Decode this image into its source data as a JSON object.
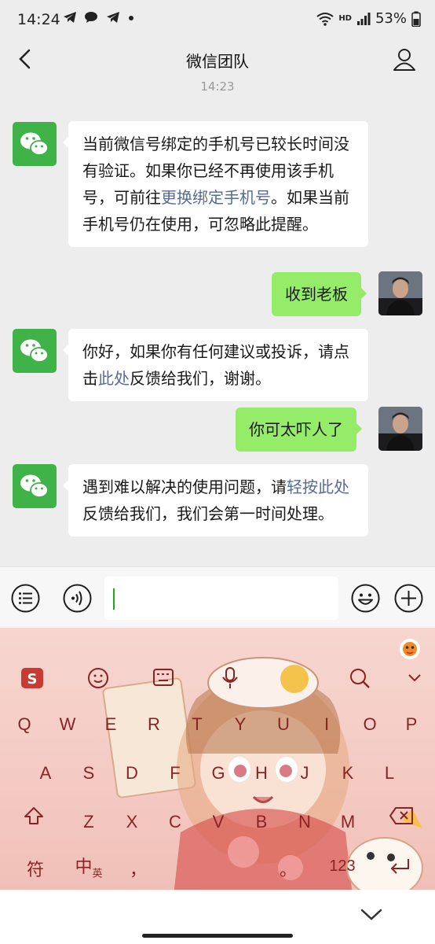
{
  "status_bar": {
    "time": "14:24",
    "notification_icons": [
      "telegram-icon",
      "chat-icon",
      "telegram-icon",
      "dot-icon"
    ],
    "hd": "HD",
    "battery": "53%"
  },
  "header": {
    "title": "微信团队"
  },
  "chat": {
    "timestamp": "14:23",
    "messages": [
      {
        "side": "in",
        "parts": [
          {
            "text": "当前微信号绑定的手机号已较长时间没有验证。如果你已经不再使用该手机号，可前往"
          },
          {
            "text": "更换绑定手机号",
            "link": true
          },
          {
            "text": "。如果当前手机号仍在使用，可忽略此提醒。"
          }
        ]
      },
      {
        "side": "out",
        "text": "收到老板"
      },
      {
        "side": "in",
        "parts": [
          {
            "text": "你好，如果你有任何建议或投诉，请点击"
          },
          {
            "text": "此处",
            "link": true
          },
          {
            "text": "反馈给我们，谢谢。"
          }
        ]
      },
      {
        "side": "out",
        "text": "你可太吓人了"
      },
      {
        "side": "in",
        "parts": [
          {
            "text": "遇到难以解决的使用问题，请"
          },
          {
            "text": "轻按此处",
            "link": true
          },
          {
            "text": "反馈给我们，我们会第一时间处理。"
          }
        ]
      }
    ]
  },
  "input": {
    "value": ""
  },
  "keyboard": {
    "row1": [
      "Q",
      "W",
      "E",
      "R",
      "T",
      "Y",
      "U",
      "I",
      "O",
      "P"
    ],
    "row2": [
      "A",
      "S",
      "D",
      "F",
      "G",
      "H",
      "J",
      "K",
      "L"
    ],
    "row3": [
      "Z",
      "X",
      "C",
      "V",
      "B",
      "N",
      "M"
    ],
    "symbols_label": "符",
    "lang_main": "中",
    "lang_sub": "英",
    "comma": "，",
    "period": "。",
    "numbers_label": "123"
  },
  "colors": {
    "accent": "#95ec69",
    "brand": "#3fb248",
    "link": "#576b95"
  }
}
